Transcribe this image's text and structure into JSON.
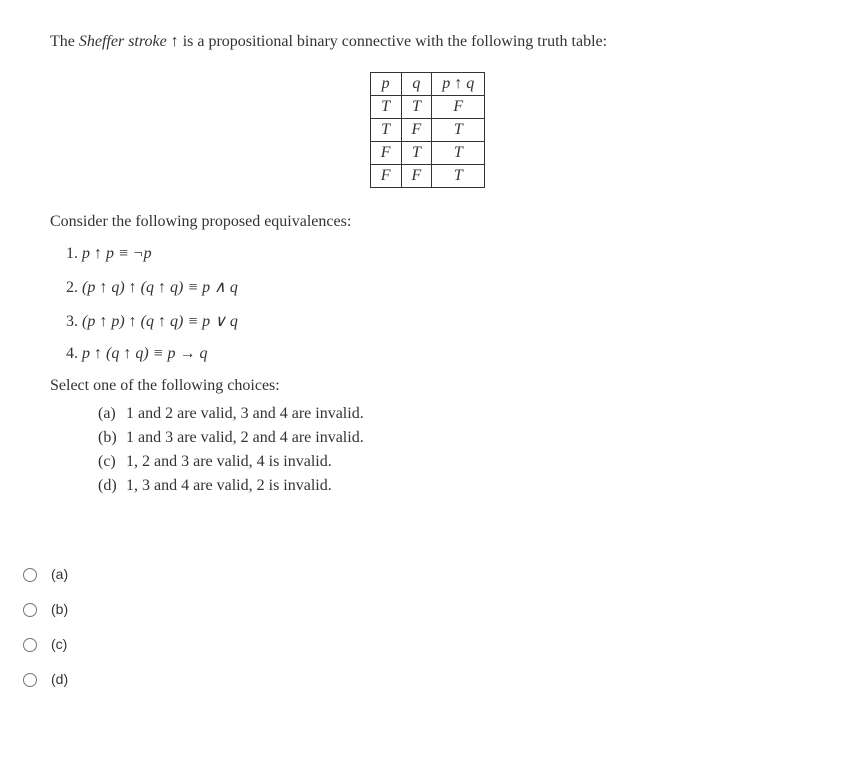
{
  "intro": {
    "prefix": "The ",
    "term": "Sheffer stroke",
    "symbol": " ↑ ",
    "rest": "is a propositional binary connective with the following truth table:"
  },
  "table": {
    "headers": {
      "p": "p",
      "q": "q",
      "pq": "p ↑ q"
    },
    "rows": [
      {
        "p": "T",
        "q": "T",
        "r": "F"
      },
      {
        "p": "T",
        "q": "F",
        "r": "T"
      },
      {
        "p": "F",
        "q": "T",
        "r": "T"
      },
      {
        "p": "F",
        "q": "F",
        "r": "T"
      }
    ]
  },
  "consider": "Consider the following proposed equivalences:",
  "equiv": [
    "p ↑ p  ≡  ¬p",
    "(p ↑ q) ↑ (q ↑ q)  ≡  p ∧ q",
    "(p ↑ p) ↑ (q ↑ q)  ≡  p ∨ q",
    "p ↑ (q ↑ q)  ≡  p → q"
  ],
  "selectText": "Select one of the following choices:",
  "choices": [
    {
      "label": "(a)",
      "text": "1 and 2 are valid, 3 and 4 are invalid."
    },
    {
      "label": "(b)",
      "text": "1 and 3 are valid, 2 and 4 are invalid."
    },
    {
      "label": "(c)",
      "text": "1, 2 and 3 are valid, 4 is invalid."
    },
    {
      "label": "(d)",
      "text": "1, 3 and 4 are valid, 2 is invalid."
    }
  ],
  "radios": [
    {
      "label": "(a)"
    },
    {
      "label": "(b)"
    },
    {
      "label": "(c)"
    },
    {
      "label": "(d)"
    }
  ]
}
